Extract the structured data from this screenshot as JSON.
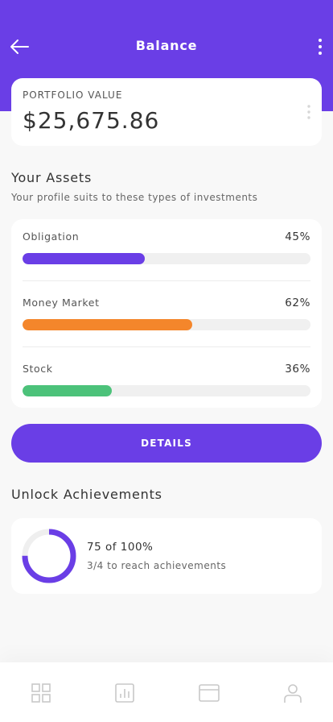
{
  "header": {
    "title": "Balance"
  },
  "portfolio": {
    "label": "PORTFOLIO VALUE",
    "value": "$25,675.86"
  },
  "assets": {
    "title": "Your Assets",
    "subtitle": "Your profile suits to these types of investments",
    "items": [
      {
        "name": "Obligation",
        "percent_label": "45%",
        "fill_fraction": 0.425,
        "color": "#6a3ee6"
      },
      {
        "name": "Money Market",
        "percent_label": "62%",
        "fill_fraction": 0.59,
        "color": "#f4862b"
      },
      {
        "name": "Stock",
        "percent_label": "36%",
        "fill_fraction": 0.31,
        "color": "#4cc27a"
      }
    ]
  },
  "details_button": {
    "label": "DETAILS"
  },
  "achievements": {
    "title": "Unlock Achievements",
    "progress_text": "75 of 100%",
    "progress_fraction": 0.75,
    "subtitle": "3/4 to reach achievements"
  },
  "colors": {
    "accent": "#6a3ee6",
    "track": "#f0f0f0",
    "nav_icon": "#c8c8c8"
  },
  "bottom_nav": {
    "items": [
      {
        "icon": "dashboard-grid-icon"
      },
      {
        "icon": "bar-chart-icon"
      },
      {
        "icon": "card-icon"
      },
      {
        "icon": "profile-icon"
      }
    ]
  }
}
